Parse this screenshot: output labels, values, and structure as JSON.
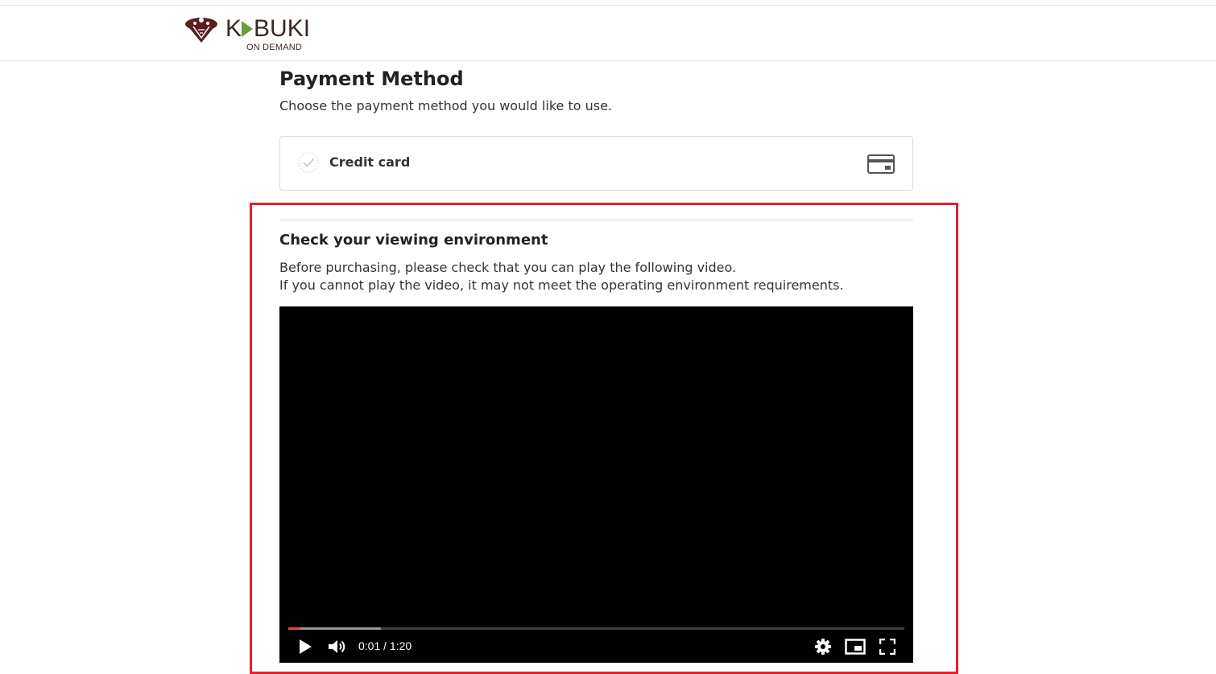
{
  "brand": {
    "logo_text_k": "K",
    "logo_text_rest": "BUKI",
    "logo_subtitle": "ON DEMAND",
    "logo_color": "#3a2a22",
    "arrow_color": "#6a9b3a",
    "crest_color": "#5b1f1f"
  },
  "payment": {
    "title": "Payment Method",
    "subtitle": "Choose the payment method you would like to use.",
    "options": [
      {
        "label": "Credit card",
        "icon": "credit-card-icon",
        "selected": false
      }
    ]
  },
  "viewing_check": {
    "title": "Check your viewing environment",
    "line1": "Before purchasing, please check that you can play the following video.",
    "line2": "If you cannot play the video, it may not meet the operating environment requirements.",
    "highlight_color": "#e5202e"
  },
  "video_player": {
    "time_display": "0:01 / 1:20",
    "played_fraction": 0.0125,
    "buffered_fraction": 0.15,
    "played_color": "#e0494f",
    "controls": [
      "play-icon",
      "volume-icon",
      "settings-gear-icon",
      "picture-in-picture-icon",
      "fullscreen-icon"
    ]
  }
}
